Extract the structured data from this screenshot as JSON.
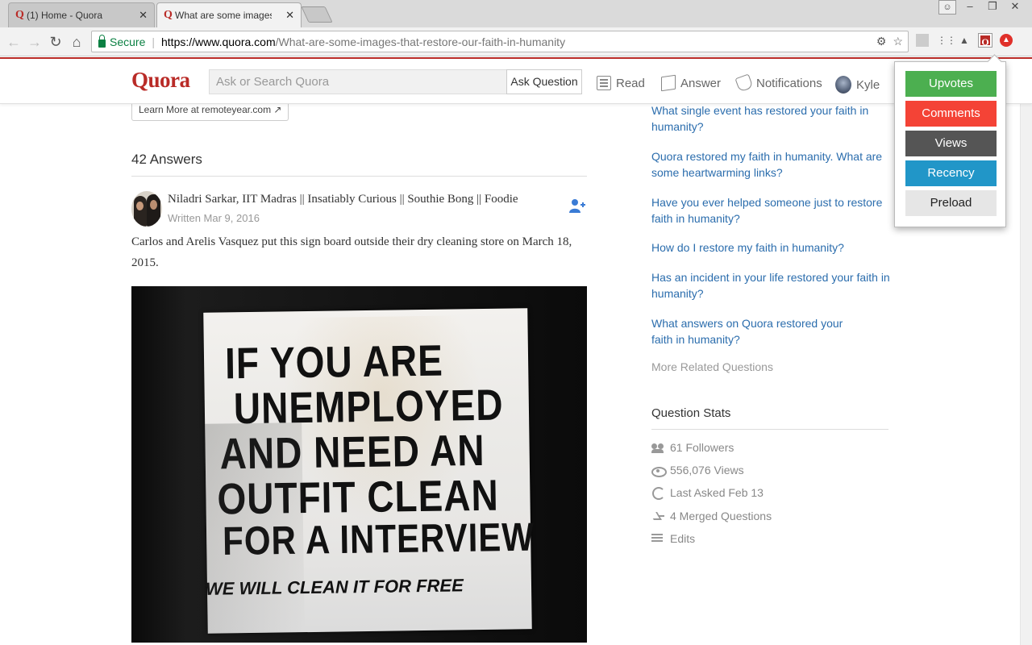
{
  "browser": {
    "tabs": [
      {
        "favicon": "Q",
        "title": "(1) Home - Quora",
        "close": "✕"
      },
      {
        "favicon": "Q",
        "title": "What are some images t",
        "close": "✕"
      }
    ],
    "secure_label": "Secure",
    "url_host": "https://www.quora.com",
    "url_path": "/What-are-some-images-that-restore-our-faith-in-humanity"
  },
  "header": {
    "logo": "Quora",
    "search_placeholder": "Ask or Search Quora",
    "ask_button": "Ask Question",
    "nav": {
      "read": "Read",
      "answer": "Answer",
      "notifications": "Notifications",
      "user": "Kyle"
    }
  },
  "main": {
    "learn_more": "Learn More at remoteyear.com",
    "answers_count": "42 Answers",
    "author": {
      "name": "Niladri Sarkar, IIT Madras || Insatiably Curious || Southie Bong || Foodie",
      "written": "Written Mar 9, 2016"
    },
    "answer_text": "Carlos and Arelis Vasquez put this sign board outside their dry cleaning store on March 18, 2015.",
    "sign_lines": [
      "IF YOU ARE",
      "UNEMPLOYED",
      "AND NEED AN",
      "OUTFIT CLEAN",
      "FOR A INTERVIEW",
      "WE WILL CLEAN IT FOR FREE"
    ]
  },
  "sidebar": {
    "related_questions": [
      "What single event has restored your faith in humanity?",
      "Quora restored my faith in humanity. What are some heartwarming links?",
      "Have you ever helped someone just to restore faith in humanity?",
      "How do I restore my faith in humanity?",
      "Has an incident in your life restored your faith in humanity?",
      "What answers on Quora restored your faith in humanity?"
    ],
    "more_related": "More Related Questions",
    "stats_title": "Question Stats",
    "stats": {
      "followers": "61 Followers",
      "views": "556,076 Views",
      "last_asked": "Last Asked Feb 13",
      "merged": "4 Merged Questions",
      "edits": "Edits"
    }
  },
  "popup": {
    "buttons": [
      {
        "label": "Upvotes",
        "bg": "#4caf50",
        "color": "#ffffff"
      },
      {
        "label": "Comments",
        "bg": "#f44336",
        "color": "#ffffff"
      },
      {
        "label": "Views",
        "bg": "#555555",
        "color": "#ffffff"
      },
      {
        "label": "Recency",
        "bg": "#2196c8",
        "color": "#ffffff"
      },
      {
        "label": "Preload",
        "bg": "#e6e6e6",
        "color": "#222222"
      }
    ]
  },
  "colors": {
    "brand": "#b92b27",
    "link": "#2b6dad",
    "secure": "#0b8043"
  }
}
